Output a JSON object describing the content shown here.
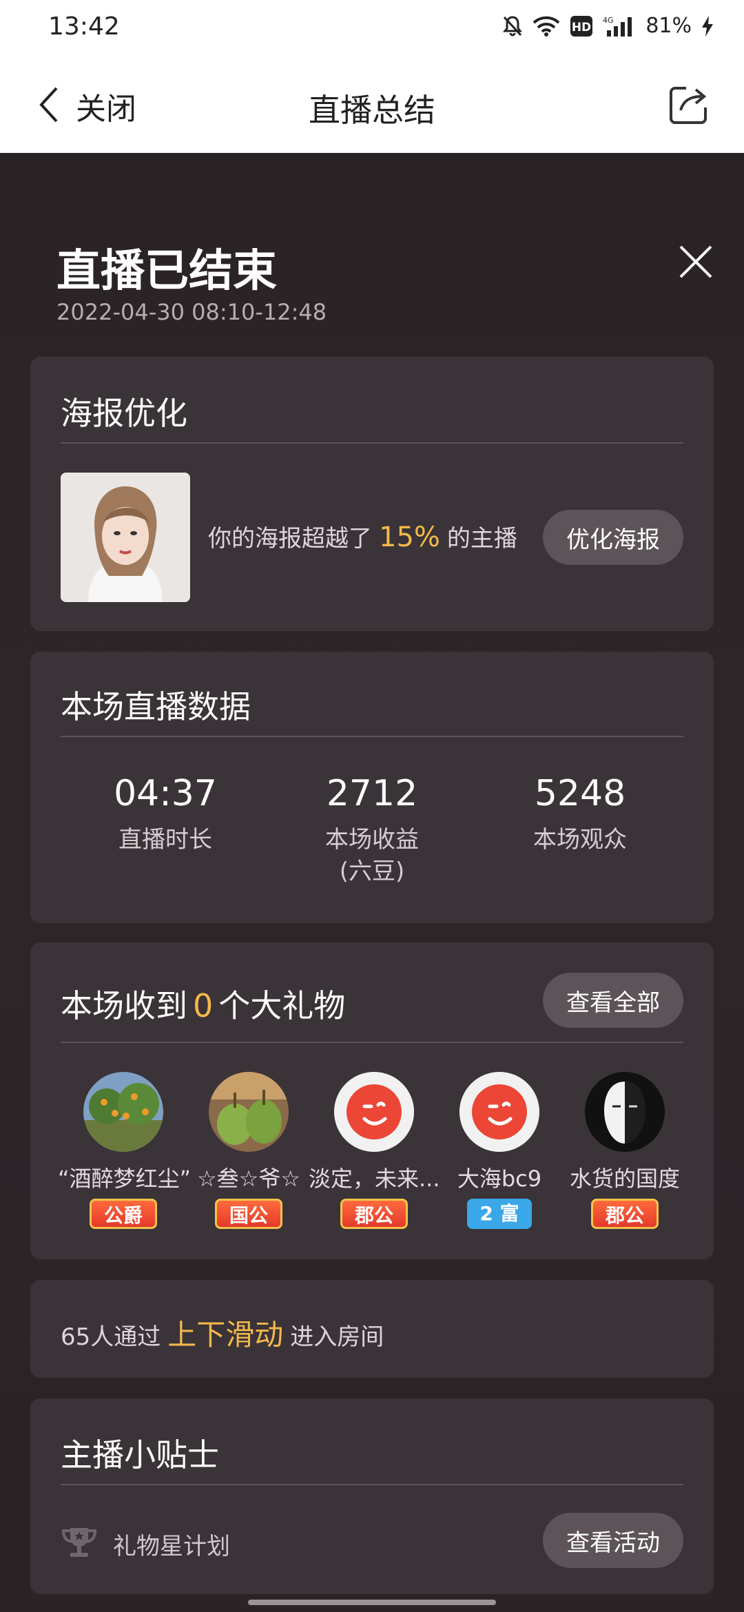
{
  "status_bar": {
    "time": "13:42",
    "signal": "4G",
    "battery": "81%"
  },
  "nav": {
    "back_label": "关闭",
    "title": "直播总结"
  },
  "summary": {
    "title": "直播已结束",
    "time_range": "2022-04-30 08:10-12:48"
  },
  "poster": {
    "title": "海报优化",
    "text_before": "你的海报超越了",
    "percent": "15%",
    "text_after": "的主播",
    "button": "优化海报"
  },
  "stats": {
    "title": "本场直播数据",
    "items": [
      {
        "value": "04:37",
        "label": "直播时长"
      },
      {
        "value": "2712",
        "label": "本场收益\n(六豆)"
      },
      {
        "value": "5248",
        "label": "本场观众"
      }
    ]
  },
  "gifts": {
    "title_before": "本场收到",
    "count": "0",
    "title_after": "个大礼物",
    "button": "查看全部",
    "donors": [
      {
        "name": "“酒醉梦红尘”",
        "badge": "公爵",
        "badge_color": "#e53a2a"
      },
      {
        "name": "☆叁☆爷☆",
        "badge": "国公",
        "badge_color": "#e53a2a"
      },
      {
        "name": "淡定，未来...",
        "badge": "郡公",
        "badge_color": "#e53a2a"
      },
      {
        "name": "大海bc9",
        "badge": "2 富",
        "badge_color": "#3aa7e9"
      },
      {
        "name": "水货的国度",
        "badge": "郡公",
        "badge_color": "#e53a2a"
      }
    ]
  },
  "swipe": {
    "text_before": "65人通过",
    "highlight": "上下滑动",
    "text_after": "进入房间"
  },
  "tips": {
    "title": "主播小贴士",
    "item_label": "礼物星计划",
    "button": "查看活动"
  },
  "colors": {
    "accent": "#f2b84a",
    "card": "#3a3338",
    "background": "#2b2529"
  }
}
